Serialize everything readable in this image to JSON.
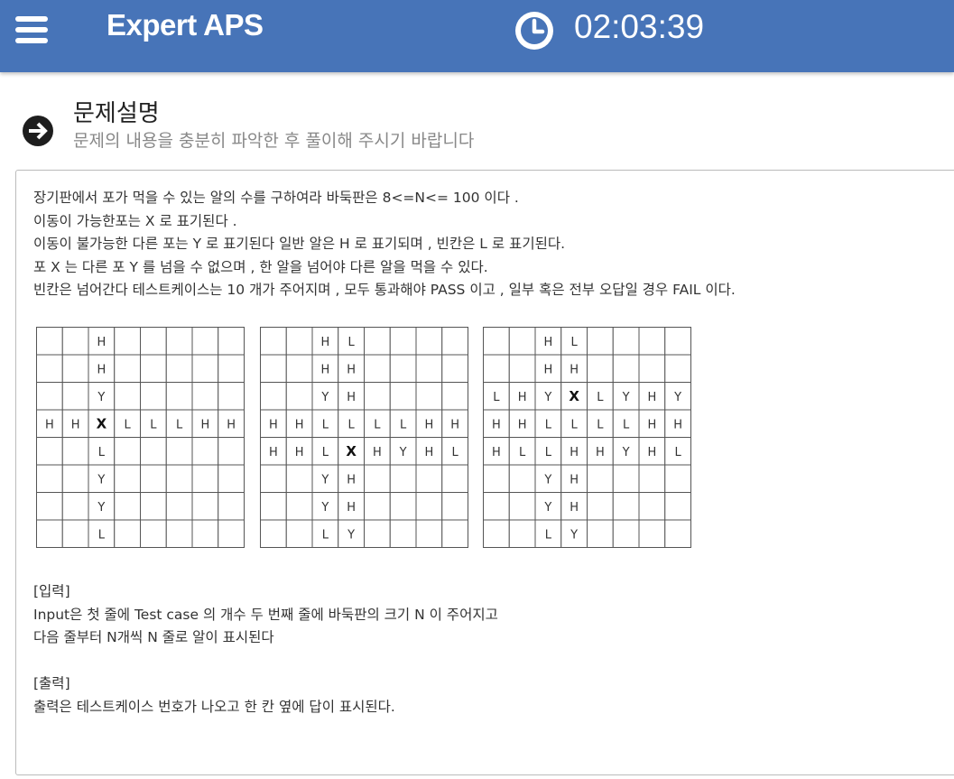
{
  "header": {
    "brand": "Expert APS",
    "timer": "02:03:39",
    "menu_icon": "hamburger-menu-icon",
    "clock_icon": "clock-icon",
    "bg_color": "#4774b8"
  },
  "section": {
    "title": "문제설명",
    "subtitle": "문제의 내용을 충분히 파악한 후 풀이해 주시기 바랍니다",
    "icon": "arrow-right-circle-icon"
  },
  "description": [
    "장기판에서 포가 먹을 수 있는 알의 수를 구하여라 바둑판은 8<=N<= 100 이다 .",
    "이동이 가능한포는 X 로 표기된다 .",
    "이동이 불가능한 다른 포는 Y 로 표기된다 일반 알은 H 로 표기되며 , 빈칸은 L 로 표기된다.",
    "포 X 는 다른 포 Y 를 넘을 수 없으며 , 한 알을 넘어야 다른 알을 먹을 수 있다.",
    "빈칸은 넘어간다 테스트케이스는 10 개가 주어지며 , 모두 통과해야 PASS 이고 , 일부 혹은 전부 오답일 경우 FAIL 이다."
  ],
  "boards": [
    [
      [
        "",
        "",
        "H",
        "",
        "",
        "",
        "",
        ""
      ],
      [
        "",
        "",
        "H",
        "",
        "",
        "",
        "",
        ""
      ],
      [
        "",
        "",
        "Y",
        "",
        "",
        "",
        "",
        ""
      ],
      [
        "H",
        "H",
        "X",
        "L",
        "L",
        "L",
        "H",
        "H"
      ],
      [
        "",
        "",
        "L",
        "",
        "",
        "",
        "",
        ""
      ],
      [
        "",
        "",
        "Y",
        "",
        "",
        "",
        "",
        ""
      ],
      [
        "",
        "",
        "Y",
        "",
        "",
        "",
        "",
        ""
      ],
      [
        "",
        "",
        "L",
        "",
        "",
        "",
        "",
        ""
      ]
    ],
    [
      [
        "",
        "",
        "H",
        "L",
        "",
        "",
        "",
        ""
      ],
      [
        "",
        "",
        "H",
        "H",
        "",
        "",
        "",
        ""
      ],
      [
        "",
        "",
        "Y",
        "H",
        "",
        "",
        "",
        ""
      ],
      [
        "H",
        "H",
        "L",
        "L",
        "L",
        "L",
        "H",
        "H"
      ],
      [
        "H",
        "H",
        "L",
        "X",
        "H",
        "Y",
        "H",
        "L"
      ],
      [
        "",
        "",
        "Y",
        "H",
        "",
        "",
        "",
        ""
      ],
      [
        "",
        "",
        "Y",
        "H",
        "",
        "",
        "",
        ""
      ],
      [
        "",
        "",
        "L",
        "Y",
        "",
        "",
        "",
        ""
      ]
    ],
    [
      [
        "",
        "",
        "H",
        "L",
        "",
        "",
        "",
        ""
      ],
      [
        "",
        "",
        "H",
        "H",
        "",
        "",
        "",
        ""
      ],
      [
        "L",
        "H",
        "Y",
        "X",
        "L",
        "Y",
        "H",
        "Y"
      ],
      [
        "H",
        "H",
        "L",
        "L",
        "L",
        "L",
        "H",
        "H"
      ],
      [
        "H",
        "L",
        "L",
        "H",
        "H",
        "Y",
        "H",
        "L"
      ],
      [
        "",
        "",
        "Y",
        "H",
        "",
        "",
        "",
        ""
      ],
      [
        "",
        "",
        "Y",
        "H",
        "",
        "",
        "",
        ""
      ],
      [
        "",
        "",
        "L",
        "Y",
        "",
        "",
        "",
        ""
      ]
    ]
  ],
  "io": [
    "[입력]",
    "Input은 첫 줄에 Test case 의 개수 두 번째 줄에 바둑판의 크기 N 이 주어지고",
    "다음 줄부터 N개씩 N 줄로 알이 표시된다",
    "",
    "[출력]",
    "출력은 테스트케이스 번호가 나오고 한 칸 옆에 답이 표시된다."
  ]
}
